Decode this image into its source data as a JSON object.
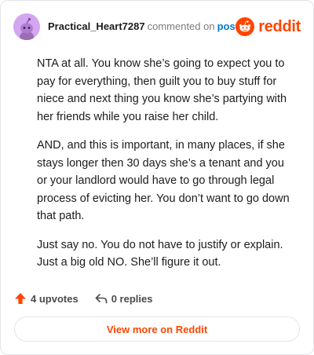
{
  "comment": {
    "username": "Practical_Heart7287",
    "action_text": "commented on",
    "post_link": "post",
    "brand": "reddit",
    "paragraphs": [
      "NTA at all. You know she’s going to expect you to pay for everything, then guilt you to buy stuff for niece and next thing you know she’s partying with her friends while you raise her child.",
      "AND, and this is important, in many places, if she stays longer then 30 days she’s a tenant and you or your landlord would have to go through legal process of evicting her. You don’t want to go down that path.",
      "Just say no. You do not have to justify or explain. Just a big old NO. She’ll figure it out."
    ]
  },
  "actions": {
    "upvotes_label": "4 upvotes",
    "replies_label": "0 replies"
  },
  "footer": {
    "view_more_label": "View more on Reddit"
  },
  "colors": {
    "brand_orange": "#ff4500",
    "link_blue": "#0079d3",
    "avatar_bg": "#d4a6f0"
  },
  "icons": {
    "avatar": "snoo-avatar-icon",
    "brand": "reddit-snoo-logo-icon",
    "upvote": "upvote-arrow-icon",
    "reply": "reply-arrow-icon"
  }
}
